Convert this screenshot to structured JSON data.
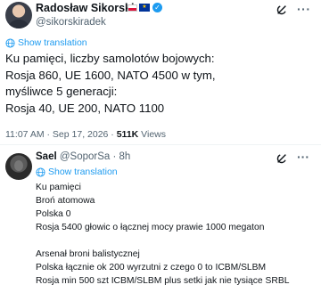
{
  "main_tweet": {
    "author_name": "Radosław Sikorski",
    "author_handle": "@sikorskiradek",
    "show_translation": "Show translation",
    "lines": [
      "Ku pamięci, liczby samolotów bojowych:",
      "Rosja 860, UE 1600, NATO 4500 w tym,",
      "myśliwce 5 generacji:",
      "Rosja 40, UE 200, NATO 1100"
    ],
    "timestamp": "11:07 AM · Sep 17, 2026 · ",
    "views_count": "511K",
    "views_label": " Views"
  },
  "reply": {
    "author_name": "Sael",
    "author_handle": "@SoporSa",
    "time": "· 8h",
    "show_translation": "Show translation",
    "lines": [
      "Ku pamięci",
      "Broń atomowa",
      "Polska 0",
      "Rosja 5400 głowic o łącznej mocy prawie 1000 megaton",
      "",
      "Arsenał broni balistycznej",
      "Polska łącznie ok 200 wyrzutni z czego 0 to ICBM/SLBM",
      "Rosja min 500 szt ICBM/SLBM plus setki jak nie tysiące SRBL"
    ]
  },
  "icons": {
    "grok": "grok-icon",
    "more": "more-icon",
    "globe": "globe-icon",
    "verified": "verified-badge-icon",
    "flag_pl": "poland-flag-icon",
    "flag_eu": "eu-flag-icon"
  },
  "colors": {
    "accent": "#1d9bf0",
    "secondary_text": "#536471",
    "primary_text": "#0f1419"
  }
}
